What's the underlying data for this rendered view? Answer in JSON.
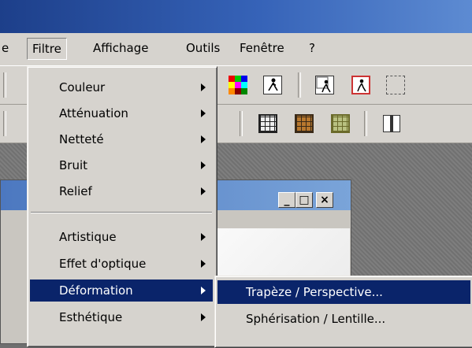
{
  "menubar": {
    "items": [
      {
        "label": "e"
      },
      {
        "label": "Filtre"
      },
      {
        "label": "Affichage"
      },
      {
        "label": "Outils"
      },
      {
        "label": "Fenêtre"
      },
      {
        "label": "?"
      }
    ]
  },
  "filter_menu": {
    "items": [
      {
        "label": "Couleur"
      },
      {
        "label": "Atténuation"
      },
      {
        "label": "Netteté"
      },
      {
        "label": "Bruit"
      },
      {
        "label": "Relief"
      },
      {
        "label": "Artistique"
      },
      {
        "label": "Effet d'optique"
      },
      {
        "label": "Déformation"
      },
      {
        "label": "Esthétique"
      }
    ],
    "highlighted": "Déformation"
  },
  "deformation_submenu": {
    "items": [
      {
        "label": "Trapèze / Perspective..."
      },
      {
        "label": "Sphérisation / Lentille..."
      }
    ],
    "highlighted": "Trapèze / Perspective..."
  },
  "child_window": {
    "minimize_label": "_",
    "maximize_label": "□",
    "close_label": "×"
  },
  "colors": {
    "menu_bg": "#d6d3ce",
    "highlight": "#0a246a",
    "title_bar": "#1d3f8a"
  }
}
